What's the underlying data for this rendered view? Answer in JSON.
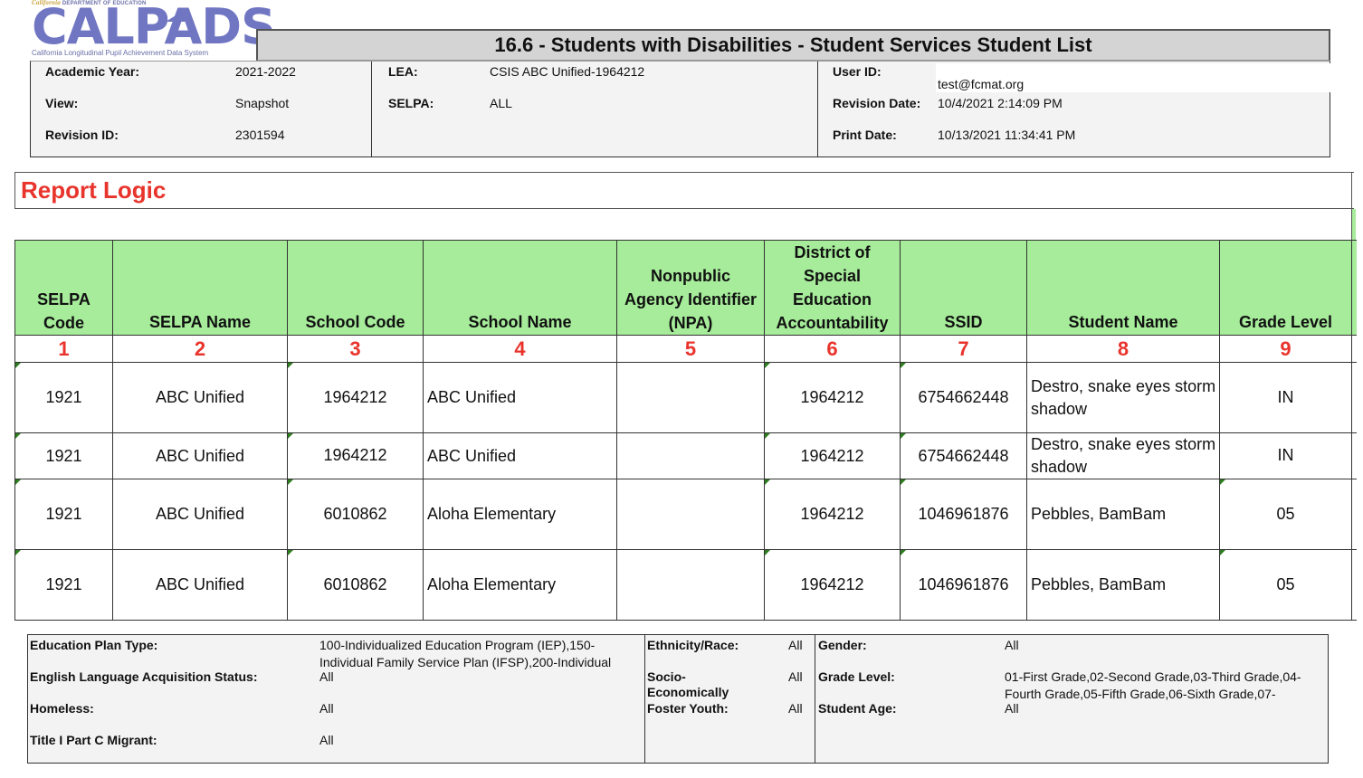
{
  "logo": {
    "dept_prefix": "California",
    "dept_text": "DEPARTMENT OF EDUCATION",
    "wordmark": "CALPADS",
    "subtitle": "California Longitudinal Pupil Achievement Data System"
  },
  "report": {
    "title": "16.6 -  Students with Disabilities - Student Services Student List"
  },
  "header_info": {
    "academic_year_label": "Academic Year:",
    "academic_year": "2021-2022",
    "view_label": "View:",
    "view": "Snapshot",
    "revision_id_label": "Revision ID:",
    "revision_id": "2301594",
    "lea_label": "LEA:",
    "lea": "CSIS ABC Unified-1964212",
    "selpa_label": "SELPA:",
    "selpa": "ALL",
    "user_id_label": "User ID:",
    "user_id": "test@fcmat.org",
    "revision_date_label": "Revision Date:",
    "revision_date": "10/4/2021 2:14:09 PM",
    "print_date_label": "Print Date:",
    "print_date": "10/13/2021 11:34:41 PM"
  },
  "report_logic": {
    "heading": "Report Logic"
  },
  "table": {
    "columns": [
      {
        "label": "SELPA Code",
        "number": "1"
      },
      {
        "label": "SELPA Name",
        "number": "2"
      },
      {
        "label": "School Code",
        "number": "3"
      },
      {
        "label": "School Name",
        "number": "4"
      },
      {
        "label": "Nonpublic Agency Identifier (NPA)",
        "number": "5"
      },
      {
        "label": "District of Special Education Accountability",
        "number": "6"
      },
      {
        "label": "SSID",
        "number": "7"
      },
      {
        "label": "Student Name",
        "number": "8"
      },
      {
        "label": "Grade Level",
        "number": "9"
      }
    ],
    "rows": [
      {
        "selpa_code": "1921",
        "selpa_name": "ABC Unified",
        "school_code": "1964212",
        "school_name": "ABC Unified",
        "npa": "",
        "dsea": "1964212",
        "ssid": "6754662448",
        "student_name": "Destro, snake eyes storm shadow",
        "grade_level": "IN"
      },
      {
        "selpa_code": "1921",
        "selpa_name": "ABC Unified",
        "school_code": "1964212",
        "school_name": "ABC Unified",
        "npa": "",
        "dsea": "1964212",
        "ssid": "6754662448",
        "student_name": "Destro, snake eyes storm shadow",
        "grade_level": "IN"
      },
      {
        "selpa_code": "1921",
        "selpa_name": "ABC Unified",
        "school_code": "6010862",
        "school_name": "Aloha Elementary",
        "npa": "",
        "dsea": "1964212",
        "ssid": "1046961876",
        "student_name": "Pebbles, BamBam",
        "grade_level": "05"
      },
      {
        "selpa_code": "1921",
        "selpa_name": "ABC Unified",
        "school_code": "6010862",
        "school_name": "Aloha Elementary",
        "npa": "",
        "dsea": "1964212",
        "ssid": "1046961876",
        "student_name": "Pebbles, BamBam",
        "grade_level": "05"
      }
    ]
  },
  "filters": {
    "education_plan_type_label": "Education Plan Type:",
    "education_plan_type": "100-Individualized Education Program (IEP),150-Individual Family Service Plan (IFSP),200-Individual",
    "ela_status_label": "English Language Acquisition Status:",
    "ela_status": "All",
    "homeless_label": "Homeless:",
    "homeless": "All",
    "migrant_label": "Title I Part C Migrant:",
    "migrant": "All",
    "ethnicity_label": "Ethnicity/Race:",
    "ethnicity": "All",
    "socio_label": "Socio-Economically",
    "socio": "All",
    "foster_label": "Foster Youth:",
    "foster": "All",
    "gender_label": "Gender:",
    "gender": "All",
    "grade_level_label": "Grade Level:",
    "grade_level": "01-First Grade,02-Second Grade,03-Third Grade,04-Fourth Grade,05-Fifth Grade,06-Sixth Grade,07-",
    "student_age_label": "Student Age:",
    "student_age": "All"
  },
  "colors": {
    "header_green": "#a6ec9a",
    "accent_red": "#e8342c",
    "logo_blue": "#7076c2",
    "marker_green": "#2e7d1f"
  }
}
